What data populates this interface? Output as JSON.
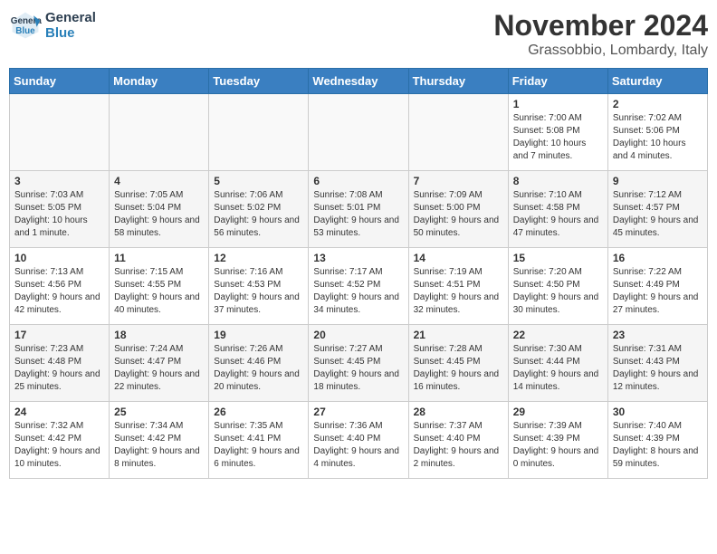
{
  "logo": {
    "line1": "General",
    "line2": "Blue"
  },
  "title": "November 2024",
  "location": "Grassobbio, Lombardy, Italy",
  "days_of_week": [
    "Sunday",
    "Monday",
    "Tuesday",
    "Wednesday",
    "Thursday",
    "Friday",
    "Saturday"
  ],
  "weeks": [
    [
      {
        "num": "",
        "info": ""
      },
      {
        "num": "",
        "info": ""
      },
      {
        "num": "",
        "info": ""
      },
      {
        "num": "",
        "info": ""
      },
      {
        "num": "",
        "info": ""
      },
      {
        "num": "1",
        "info": "Sunrise: 7:00 AM\nSunset: 5:08 PM\nDaylight: 10 hours\nand 7 minutes."
      },
      {
        "num": "2",
        "info": "Sunrise: 7:02 AM\nSunset: 5:06 PM\nDaylight: 10 hours\nand 4 minutes."
      }
    ],
    [
      {
        "num": "3",
        "info": "Sunrise: 7:03 AM\nSunset: 5:05 PM\nDaylight: 10 hours\nand 1 minute."
      },
      {
        "num": "4",
        "info": "Sunrise: 7:05 AM\nSunset: 5:04 PM\nDaylight: 9 hours\nand 58 minutes."
      },
      {
        "num": "5",
        "info": "Sunrise: 7:06 AM\nSunset: 5:02 PM\nDaylight: 9 hours\nand 56 minutes."
      },
      {
        "num": "6",
        "info": "Sunrise: 7:08 AM\nSunset: 5:01 PM\nDaylight: 9 hours\nand 53 minutes."
      },
      {
        "num": "7",
        "info": "Sunrise: 7:09 AM\nSunset: 5:00 PM\nDaylight: 9 hours\nand 50 minutes."
      },
      {
        "num": "8",
        "info": "Sunrise: 7:10 AM\nSunset: 4:58 PM\nDaylight: 9 hours\nand 47 minutes."
      },
      {
        "num": "9",
        "info": "Sunrise: 7:12 AM\nSunset: 4:57 PM\nDaylight: 9 hours\nand 45 minutes."
      }
    ],
    [
      {
        "num": "10",
        "info": "Sunrise: 7:13 AM\nSunset: 4:56 PM\nDaylight: 9 hours\nand 42 minutes."
      },
      {
        "num": "11",
        "info": "Sunrise: 7:15 AM\nSunset: 4:55 PM\nDaylight: 9 hours\nand 40 minutes."
      },
      {
        "num": "12",
        "info": "Sunrise: 7:16 AM\nSunset: 4:53 PM\nDaylight: 9 hours\nand 37 minutes."
      },
      {
        "num": "13",
        "info": "Sunrise: 7:17 AM\nSunset: 4:52 PM\nDaylight: 9 hours\nand 34 minutes."
      },
      {
        "num": "14",
        "info": "Sunrise: 7:19 AM\nSunset: 4:51 PM\nDaylight: 9 hours\nand 32 minutes."
      },
      {
        "num": "15",
        "info": "Sunrise: 7:20 AM\nSunset: 4:50 PM\nDaylight: 9 hours\nand 30 minutes."
      },
      {
        "num": "16",
        "info": "Sunrise: 7:22 AM\nSunset: 4:49 PM\nDaylight: 9 hours\nand 27 minutes."
      }
    ],
    [
      {
        "num": "17",
        "info": "Sunrise: 7:23 AM\nSunset: 4:48 PM\nDaylight: 9 hours\nand 25 minutes."
      },
      {
        "num": "18",
        "info": "Sunrise: 7:24 AM\nSunset: 4:47 PM\nDaylight: 9 hours\nand 22 minutes."
      },
      {
        "num": "19",
        "info": "Sunrise: 7:26 AM\nSunset: 4:46 PM\nDaylight: 9 hours\nand 20 minutes."
      },
      {
        "num": "20",
        "info": "Sunrise: 7:27 AM\nSunset: 4:45 PM\nDaylight: 9 hours\nand 18 minutes."
      },
      {
        "num": "21",
        "info": "Sunrise: 7:28 AM\nSunset: 4:45 PM\nDaylight: 9 hours\nand 16 minutes."
      },
      {
        "num": "22",
        "info": "Sunrise: 7:30 AM\nSunset: 4:44 PM\nDaylight: 9 hours\nand 14 minutes."
      },
      {
        "num": "23",
        "info": "Sunrise: 7:31 AM\nSunset: 4:43 PM\nDaylight: 9 hours\nand 12 minutes."
      }
    ],
    [
      {
        "num": "24",
        "info": "Sunrise: 7:32 AM\nSunset: 4:42 PM\nDaylight: 9 hours\nand 10 minutes."
      },
      {
        "num": "25",
        "info": "Sunrise: 7:34 AM\nSunset: 4:42 PM\nDaylight: 9 hours\nand 8 minutes."
      },
      {
        "num": "26",
        "info": "Sunrise: 7:35 AM\nSunset: 4:41 PM\nDaylight: 9 hours\nand 6 minutes."
      },
      {
        "num": "27",
        "info": "Sunrise: 7:36 AM\nSunset: 4:40 PM\nDaylight: 9 hours\nand 4 minutes."
      },
      {
        "num": "28",
        "info": "Sunrise: 7:37 AM\nSunset: 4:40 PM\nDaylight: 9 hours\nand 2 minutes."
      },
      {
        "num": "29",
        "info": "Sunrise: 7:39 AM\nSunset: 4:39 PM\nDaylight: 9 hours\nand 0 minutes."
      },
      {
        "num": "30",
        "info": "Sunrise: 7:40 AM\nSunset: 4:39 PM\nDaylight: 8 hours\nand 59 minutes."
      }
    ]
  ]
}
